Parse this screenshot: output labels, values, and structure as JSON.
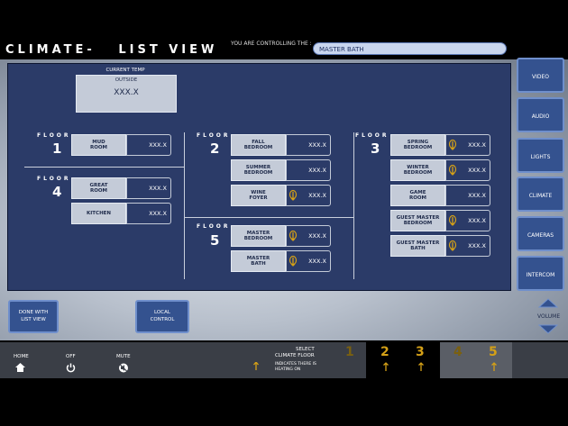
{
  "header": {
    "title": "CLIMATE-   LIST VIEW",
    "controlling_label": "YOU ARE CONTROLLING THE :",
    "controlled_room": "MASTER BATH"
  },
  "current_temp": {
    "heading": "CURRENT TEMP",
    "label": "OUTSIDE",
    "value": "XXX.X"
  },
  "floors": {
    "floor_word": "FLOOR",
    "f1": {
      "number": "1",
      "rooms": [
        {
          "name": "MUD\nROOM",
          "temp": "XXX.X",
          "heating": false
        }
      ]
    },
    "f2": {
      "number": "2",
      "rooms": [
        {
          "name": "FALL\nBEDROOM",
          "temp": "XXX.X",
          "heating": false
        },
        {
          "name": "SUMMER\nBEDROOM",
          "temp": "XXX.X",
          "heating": false
        },
        {
          "name": "WINE\nFOYER",
          "temp": "XXX.X",
          "heating": true
        }
      ]
    },
    "f3": {
      "number": "3",
      "rooms": [
        {
          "name": "SPRING\nBEDROOM",
          "temp": "XXX.X",
          "heating": true
        },
        {
          "name": "WINTER\nBEDROOM",
          "temp": "XXX.X",
          "heating": true
        },
        {
          "name": "GAME\nROOM",
          "temp": "XXX.X",
          "heating": false
        },
        {
          "name": "GUEST MASTER\nBEDROOM",
          "temp": "XXX.X",
          "heating": true
        },
        {
          "name": "GUEST MASTER\nBATH",
          "temp": "XXX.X",
          "heating": true
        }
      ]
    },
    "f4": {
      "number": "4",
      "rooms": [
        {
          "name": "GREAT\nROOM",
          "temp": "XXX.X",
          "heating": false
        },
        {
          "name": "KITCHEN",
          "temp": "XXX.X",
          "heating": false
        }
      ]
    },
    "f5": {
      "number": "5",
      "rooms": [
        {
          "name": "MASTER\nBEDROOM",
          "temp": "XXX.X",
          "heating": true
        },
        {
          "name": "MASTER\nBATH",
          "temp": "XXX.X",
          "heating": true
        }
      ]
    }
  },
  "side_nav": [
    "VIDEO",
    "AUDIO",
    "LIGHTS",
    "CLIMATE",
    "CAMERAS",
    "INTERCOM"
  ],
  "volume_label": "VOLUME",
  "actions": {
    "done": "DONE WITH\nLIST VIEW",
    "local": "LOCAL\nCONTROL"
  },
  "bottom": {
    "home": "HOME",
    "off": "OFF",
    "mute": "MUTE",
    "select_floor": "SELECT\nCLIMATE FLOOR",
    "legend": "INDICATES THERE IS\nHEATING ON",
    "floor_numbers": [
      "1",
      "2",
      "3",
      "4",
      "5"
    ],
    "floor_heating": [
      false,
      true,
      true,
      false,
      true
    ]
  },
  "colors": {
    "panel": "#2b3b68",
    "button": "#34528f",
    "accent": "#d4a017",
    "room_button": "#c4cbd8"
  }
}
